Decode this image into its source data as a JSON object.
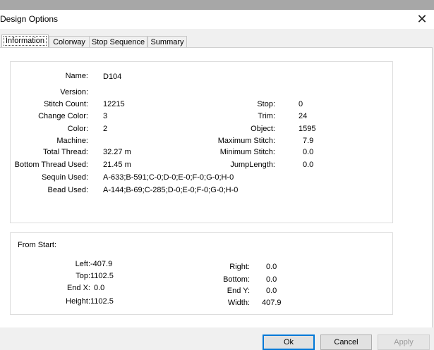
{
  "dialog": {
    "title": "Design Options",
    "close_glyph": "✕"
  },
  "tabs": [
    {
      "label": "Information",
      "active": true
    },
    {
      "label": "Colorway",
      "active": false
    },
    {
      "label": "Stop Sequence",
      "active": false
    },
    {
      "label": "Summary",
      "active": false
    }
  ],
  "info": {
    "name": {
      "label": "Name:",
      "value": "D104"
    },
    "version": {
      "label": "Version:",
      "value": ""
    },
    "stitch_count": {
      "label": "Stitch Count:",
      "value": "12215"
    },
    "change_color": {
      "label": "Change Color:",
      "value": "3"
    },
    "color": {
      "label": "Color:",
      "value": "2"
    },
    "machine": {
      "label": "Machine:",
      "value": ""
    },
    "total_thread": {
      "label": "Total Thread:",
      "value": "32.27 m"
    },
    "bottom_thread": {
      "label": "Bottom Thread Used:",
      "value": "21.45 m"
    },
    "sequin_used": {
      "label": "Sequin Used:",
      "value": "A-633;B-591;C-0;D-0;E-0;F-0;G-0;H-0"
    },
    "bead_used": {
      "label": "Bead Used:",
      "value": "A-144;B-69;C-285;D-0;E-0;F-0;G-0;H-0"
    },
    "stop": {
      "label": "Stop:",
      "value": "0"
    },
    "trim": {
      "label": "Trim:",
      "value": "24"
    },
    "object": {
      "label": "Object:",
      "value": "1595"
    },
    "max_stitch": {
      "label": "Maximum Stitch:",
      "value": "7.9"
    },
    "min_stitch": {
      "label": "Minimum Stitch:",
      "value": "0.0"
    },
    "jump_length": {
      "label": "JumpLength:",
      "value": "0.0"
    }
  },
  "from_start": {
    "heading": "From Start:",
    "left": {
      "label": "Left:",
      "value": "-407.9"
    },
    "top": {
      "label": "Top:",
      "value": "1102.5"
    },
    "end_x": {
      "label": "End X:",
      "value": "0.0"
    },
    "height": {
      "label": "Height:",
      "value": "1102.5"
    },
    "right": {
      "label": "Right:",
      "value": "0.0"
    },
    "bottom": {
      "label": "Bottom:",
      "value": "0.0"
    },
    "end_y": {
      "label": "End Y:",
      "value": "0.0"
    },
    "width": {
      "label": "Width:",
      "value": "407.9"
    }
  },
  "buttons": {
    "ok": "Ok",
    "cancel": "Cancel",
    "apply": "Apply"
  }
}
